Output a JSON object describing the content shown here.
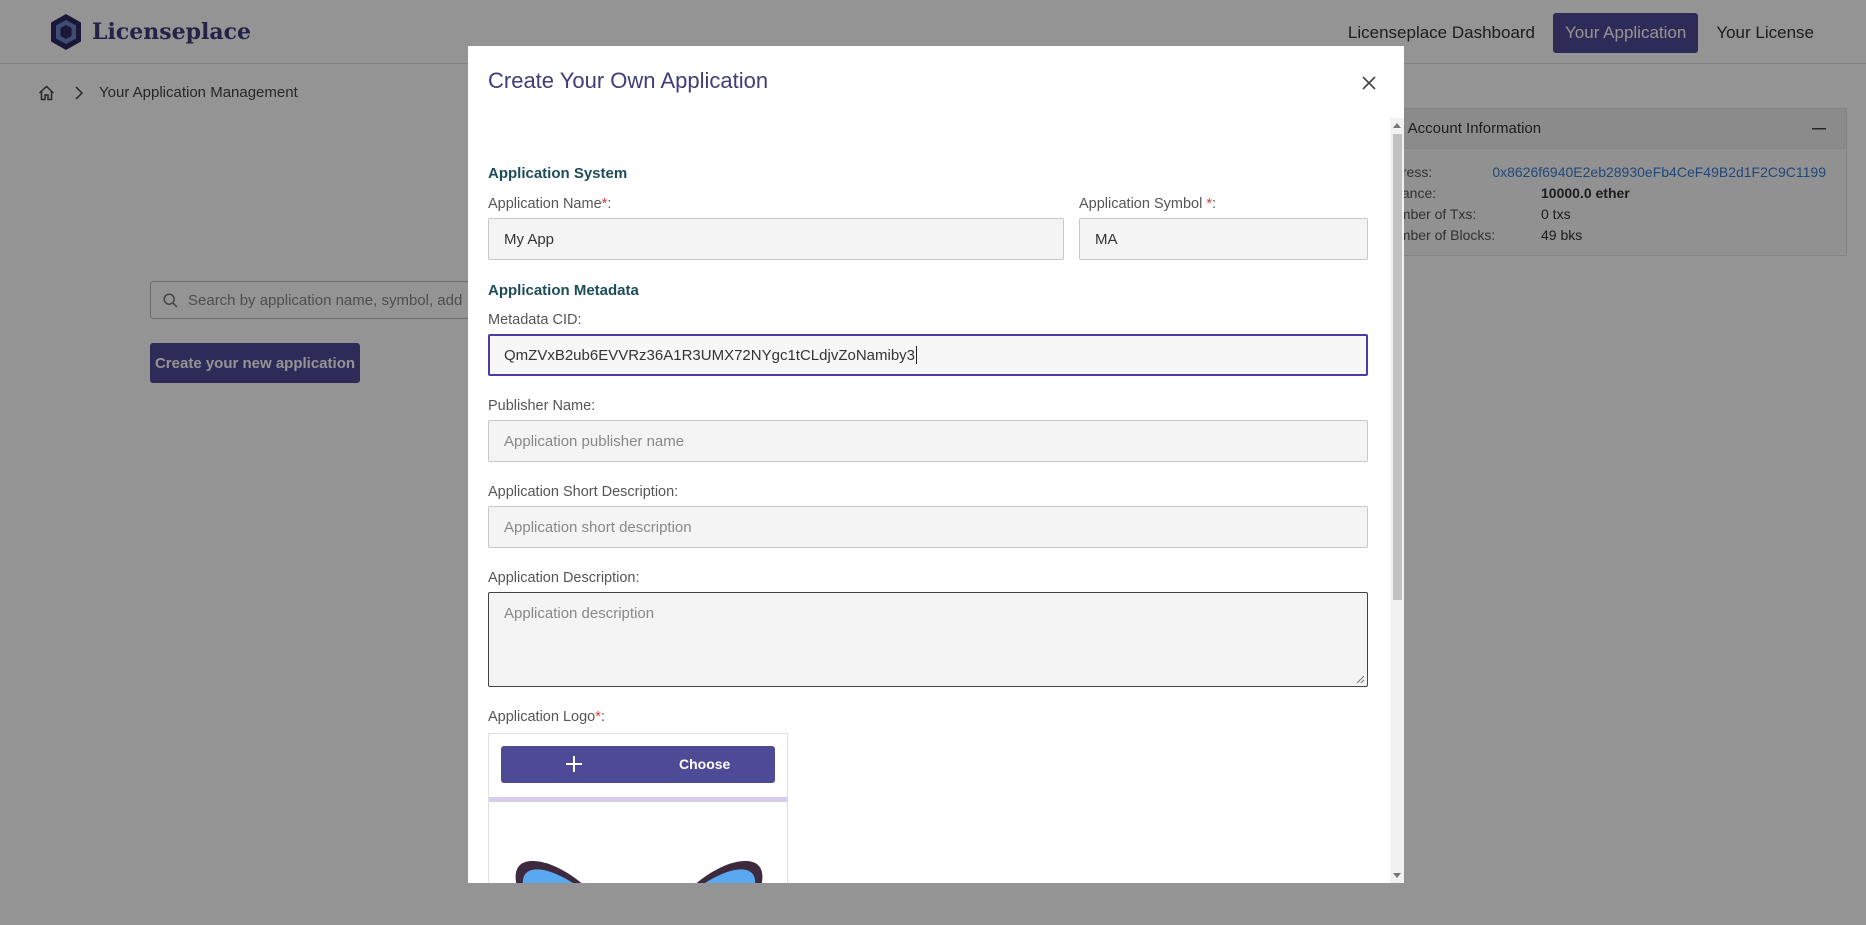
{
  "navbar": {
    "brand": "Licenseplace",
    "links": [
      {
        "label": "Licenseplace Dashboard",
        "active": false
      },
      {
        "label": "Your Application",
        "active": true
      },
      {
        "label": "Your License",
        "active": false
      }
    ]
  },
  "breadcrumb": {
    "home_icon": "home-icon",
    "current": "Your Application Management"
  },
  "page": {
    "search_placeholder": "Search by application name, symbol, add",
    "create_button": "Create your new application"
  },
  "account": {
    "title": "ur Account Information",
    "collapse_icon": "minus-icon",
    "rows": [
      {
        "label": "ldress:",
        "value": "0x8626f6940E2eb28930eFb4CeF49B2d1F2C9C1199"
      },
      {
        "label": "alance:",
        "value": "10000.0 ether"
      },
      {
        "label": "umber of Txs:",
        "value": "0 txs"
      },
      {
        "label": "umber of Blocks:",
        "value": "49 bks"
      }
    ]
  },
  "modal": {
    "title": "Create Your Own Application",
    "close_icon": "close-icon",
    "sections": {
      "system": "Application System",
      "metadata": "Application Metadata"
    },
    "fields": {
      "app_name": {
        "label": "Application Name",
        "value": "My App",
        "required_mark": "*",
        "suffix": ":"
      },
      "app_symbol": {
        "label": "Application Symbol ",
        "value": "MA",
        "required_mark": "*",
        "suffix": ":"
      },
      "metadata_cid": {
        "label": "Metadata CID:",
        "value": "QmZVxB2ub6EVVRz36A1R3UMX72NYgc1tCLdjvZoNamiby3"
      },
      "publisher_name": {
        "label": "Publisher Name:",
        "placeholder": "Application publisher name"
      },
      "short_description": {
        "label": "Application Short Description:",
        "placeholder": "Application short description"
      },
      "description": {
        "label": "Application Description:",
        "placeholder": "Application description"
      },
      "logo": {
        "label": "Application Logo",
        "required_mark": "*",
        "suffix": ":",
        "choose_label": "Choose",
        "choose_icon": "plus-icon"
      }
    },
    "upload_progress": 1.0
  },
  "colors": {
    "primary": "#4e4b96",
    "brand_text": "#3f3d7a",
    "section_title": "#1e4d5a",
    "required": "#e0383e",
    "link": "#3a7bd5",
    "progress": "#d6ccee"
  }
}
